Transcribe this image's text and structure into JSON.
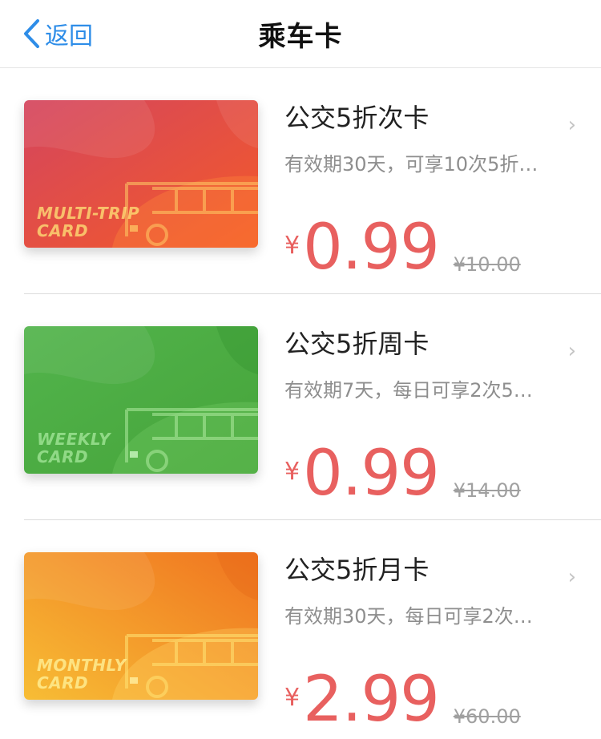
{
  "nav": {
    "back_label": "返回",
    "title": "乘车卡"
  },
  "items": [
    {
      "card_lines": [
        "MULTI-TRIP",
        "CARD"
      ],
      "title": "公交5折次卡",
      "desc": "有效期30天，可享10次5折…",
      "currency": "¥",
      "price": "0.99",
      "original": "¥10.00",
      "colors": {
        "from": "#d8485f",
        "to": "#f2582a"
      }
    },
    {
      "card_lines": [
        "WEEKLY",
        "CARD"
      ],
      "title": "公交5折周卡",
      "desc": "有效期7天，每日可享2次5…",
      "currency": "¥",
      "price": "0.99",
      "original": "¥14.00",
      "colors": {
        "from": "#4eb04a",
        "to": "#4aa83e"
      }
    },
    {
      "card_lines": [
        "MONTHLY",
        "CARD"
      ],
      "title": "公交5折月卡",
      "desc": "有效期30天，每日可享2次…",
      "currency": "¥",
      "price": "2.99",
      "original": "¥60.00",
      "colors": {
        "from": "#f5b230",
        "to": "#f07a22"
      }
    }
  ],
  "accent": "#e8605f",
  "link_color": "#2e8de8"
}
